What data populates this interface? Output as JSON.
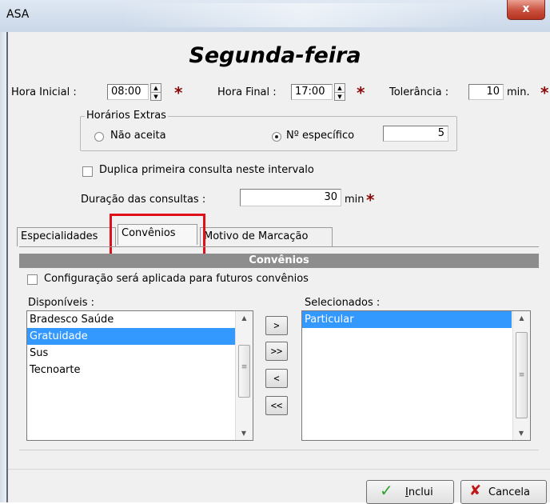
{
  "window": {
    "title": "ASA",
    "close_glyph": "x"
  },
  "heading": "Segunda-feira",
  "times": {
    "start_label": "Hora Inicial :",
    "start_value": "08:00",
    "end_label": "Hora Final :",
    "end_value": "17:00",
    "tolerance_label": "Tolerância :",
    "tolerance_value": "10",
    "tolerance_unit": "min.",
    "required_mark": "*"
  },
  "extras": {
    "title": "Horários Extras",
    "option_none": "Não aceita",
    "option_specific": "Nº específico",
    "selected": "specific",
    "count": "5"
  },
  "duplicate": {
    "label": "Duplica primeira consulta neste intervalo",
    "checked": false
  },
  "duration": {
    "label": "Duração das consultas :",
    "value": "30",
    "unit": "min",
    "required_mark": "*"
  },
  "tabs": [
    {
      "label": "Especialidades",
      "active": false
    },
    {
      "label": "Convênios",
      "active": true
    },
    {
      "label": "Motivo de Marcação",
      "active": false
    }
  ],
  "panel": {
    "header": "Convênios",
    "future_label": "Configuração será aplicada para futuros convênios",
    "future_checked": false,
    "available_label": "Disponíveis :",
    "available": [
      "Bradesco Saúde",
      "Gratuidade",
      "Sus",
      "Tecnoarte"
    ],
    "available_selected": "Gratuidade",
    "selected_label": "Selecionados :",
    "selected": [
      "Particular"
    ],
    "move_buttons": [
      ">",
      ">>",
      "<",
      "<<"
    ]
  },
  "footer": {
    "include_label": "Inclui",
    "cancel_label": "Cancela"
  },
  "colors": {
    "selection": "#3399ff",
    "required": "#8b0a0a",
    "highlight_box": "#e0101a",
    "header_bg": "#8d8d8d"
  }
}
